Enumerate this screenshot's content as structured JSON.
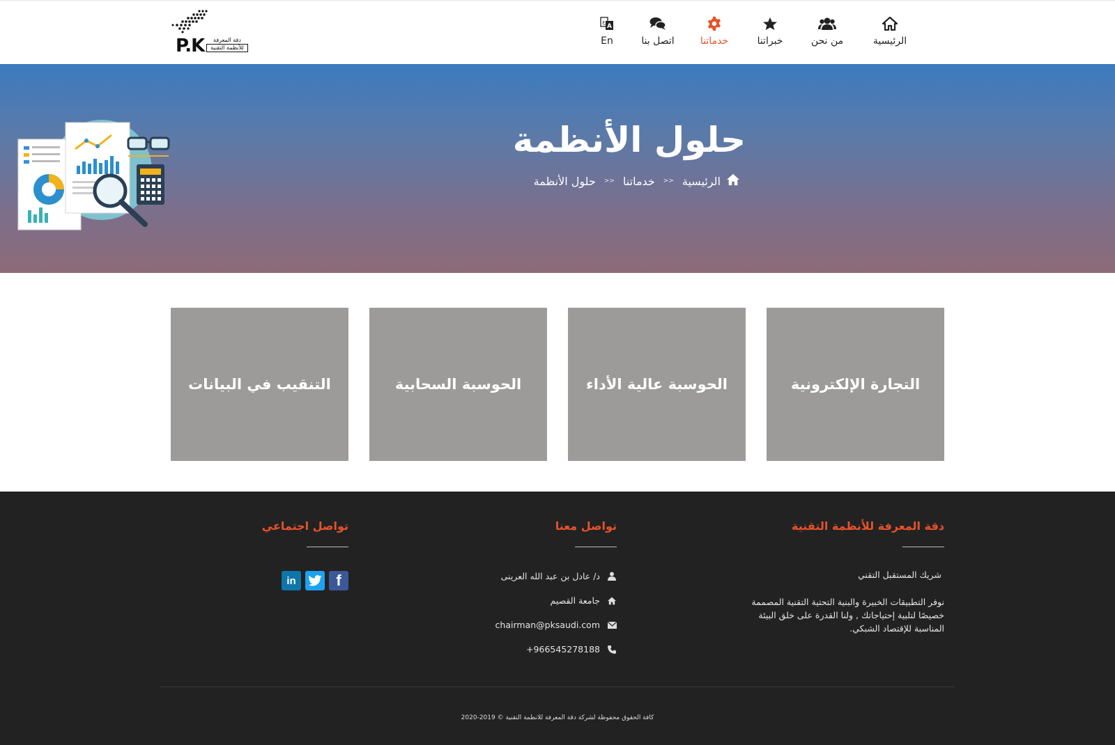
{
  "nav": {
    "items": [
      {
        "label": "الرئيسية",
        "icon": "home-icon"
      },
      {
        "label": "من نحن",
        "icon": "users-icon"
      },
      {
        "label": "خبراتنا",
        "icon": "star-icon"
      },
      {
        "label": "خدماتنا",
        "icon": "gear-icon",
        "active": true
      },
      {
        "label": "اتصل بنا",
        "icon": "chat-icon"
      },
      {
        "label": "En",
        "icon": "language-icon"
      }
    ],
    "active_color": "#e8532a"
  },
  "logo": {
    "mark": "P.K",
    "line1": "دقة المعرفة",
    "line2": "للأنظمة التقنية"
  },
  "hero": {
    "title": "حلول الأنظمة",
    "breadcrumb": [
      "الرئيسية",
      "خدماتنا",
      "حلول الأنظمة"
    ],
    "separator": "<<"
  },
  "cards": [
    {
      "label": "التنقيب في البيانات"
    },
    {
      "label": "الحوسبة السحابية"
    },
    {
      "label": "الحوسبة عالية الأداء"
    },
    {
      "label": "التجارة الإلكترونية"
    }
  ],
  "footer": {
    "about": {
      "title": "دقة المعرفة للأنظمة التقنية",
      "tagline": "شريك المستقبل التقني",
      "text": "نوفر التطبيقات الخبيرة والبنية التحتية التقنية المصممة خصيصًا لتلبية إحتياجاتك , ولنا القدرة على خلق البيئة المناسبة للإقتصاد الشبكي."
    },
    "contact": {
      "title": "تواصل معنا",
      "name": "د/ عادل بن عبد الله العرينى",
      "org": "جامعة القصيم",
      "email": "chairman@pksaudi.com",
      "phone": "+966545278188"
    },
    "social": {
      "title": "تواصل اجتماعي",
      "links": [
        "facebook",
        "twitter",
        "linkedin"
      ]
    },
    "copyright": "كافة الحقوق محفوظة لشركة دقة المعرفة للانظمة التقنية © 2019-2020",
    "accent": "#e8532a",
    "background": "#222222"
  }
}
